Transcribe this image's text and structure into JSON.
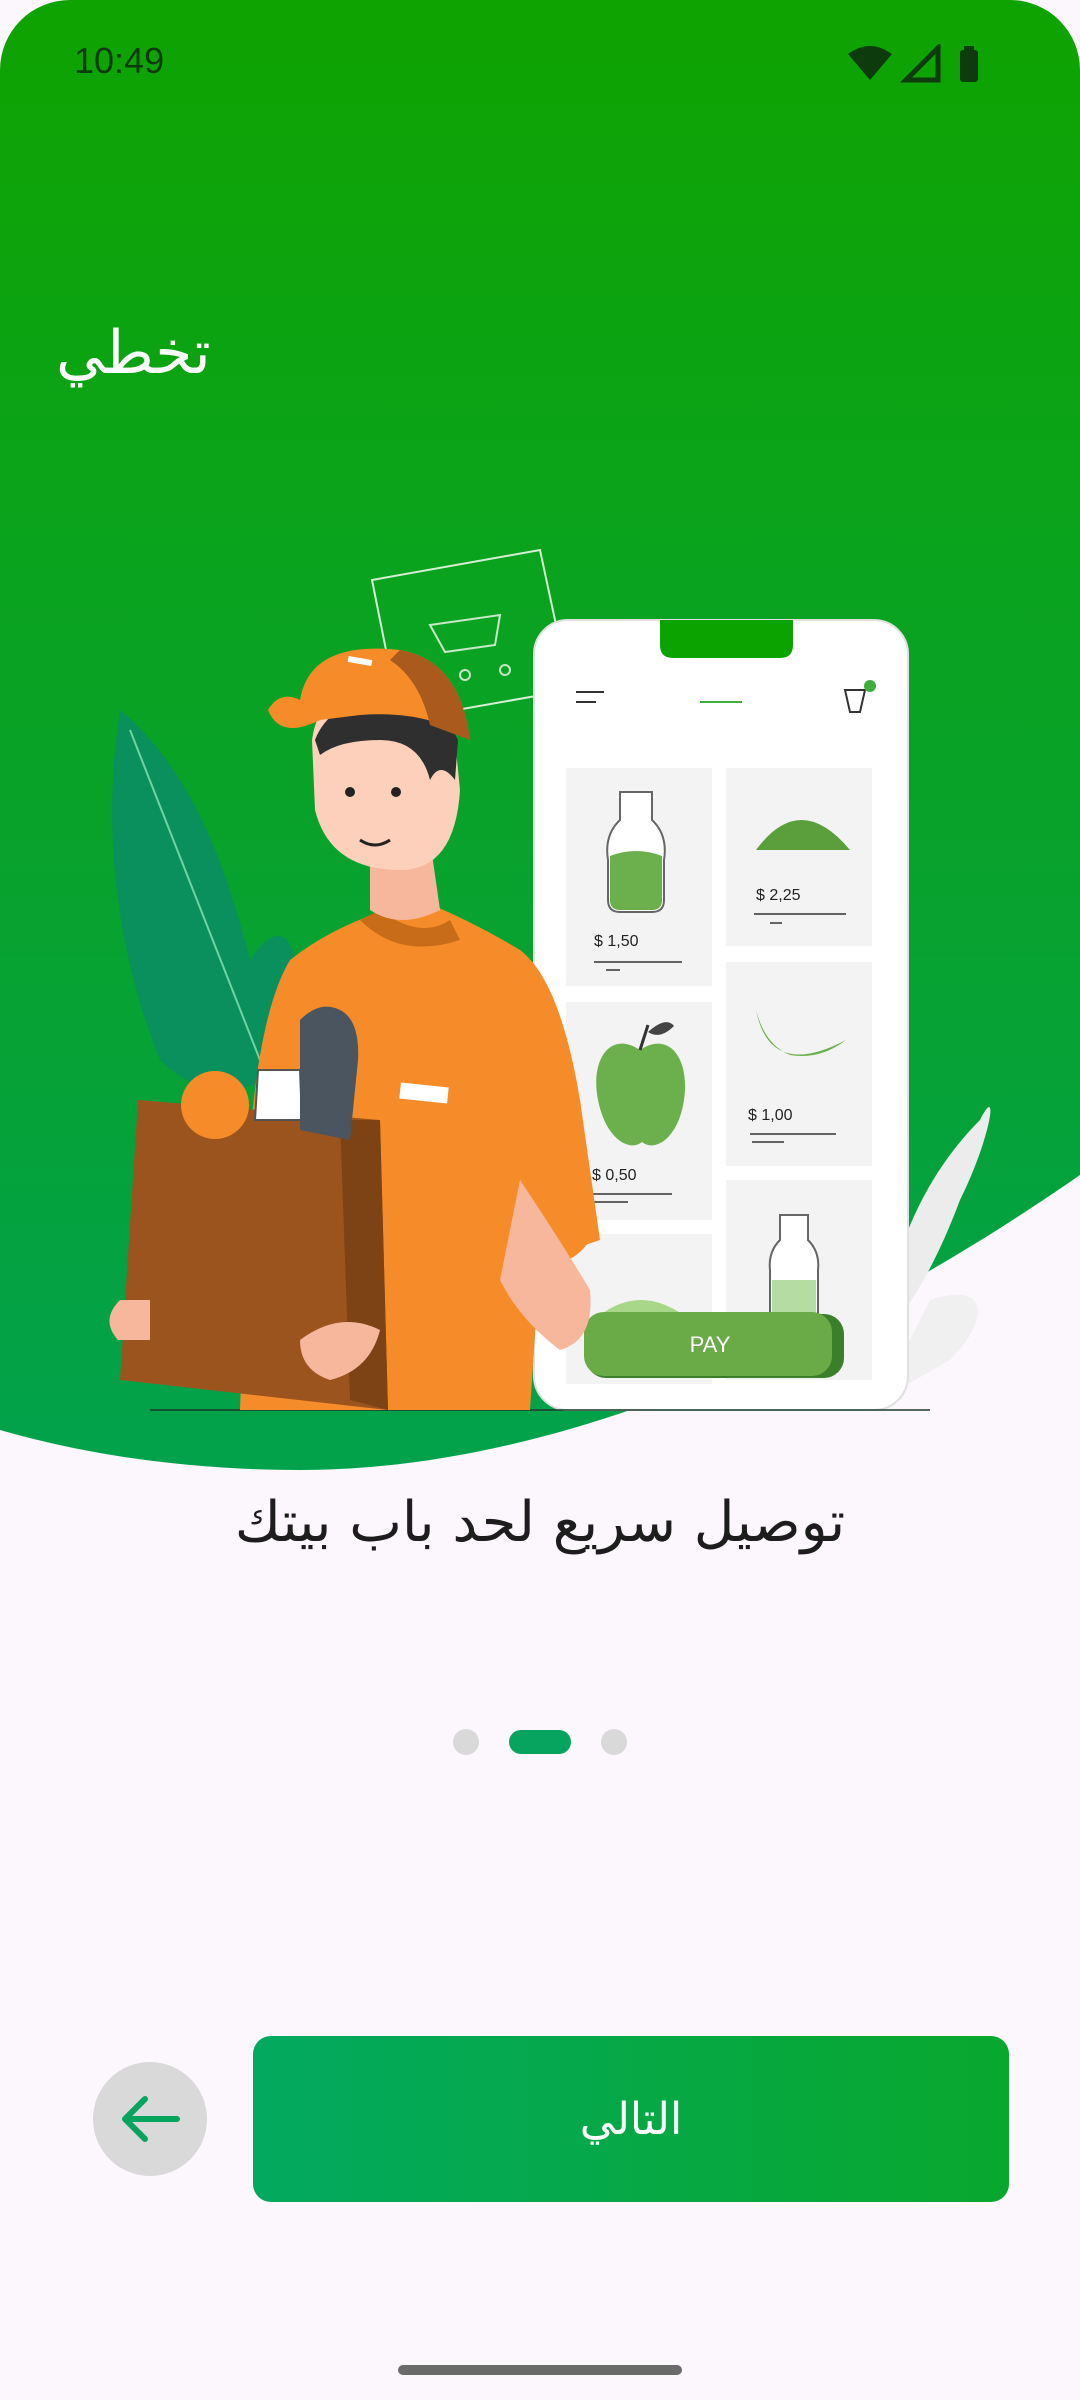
{
  "status_bar": {
    "time": "10:49",
    "icons": [
      "wifi-icon",
      "signal-icon",
      "battery-icon"
    ]
  },
  "skip_label": "تخطي",
  "illustration": {
    "prices": [
      "$ 1,50",
      "$ 2,25",
      "$ 0,50",
      "$ 1,00"
    ],
    "pay_label": "PAY"
  },
  "headline": "توصيل سريع لحد باب بيتك",
  "pagination": {
    "count": 3,
    "active_index": 1
  },
  "buttons": {
    "back": "arrow-left-icon",
    "next_label": "التالي"
  },
  "colors": {
    "primary": "#0aa500",
    "accent": "#06a45e",
    "background": "#fcf6fd"
  }
}
